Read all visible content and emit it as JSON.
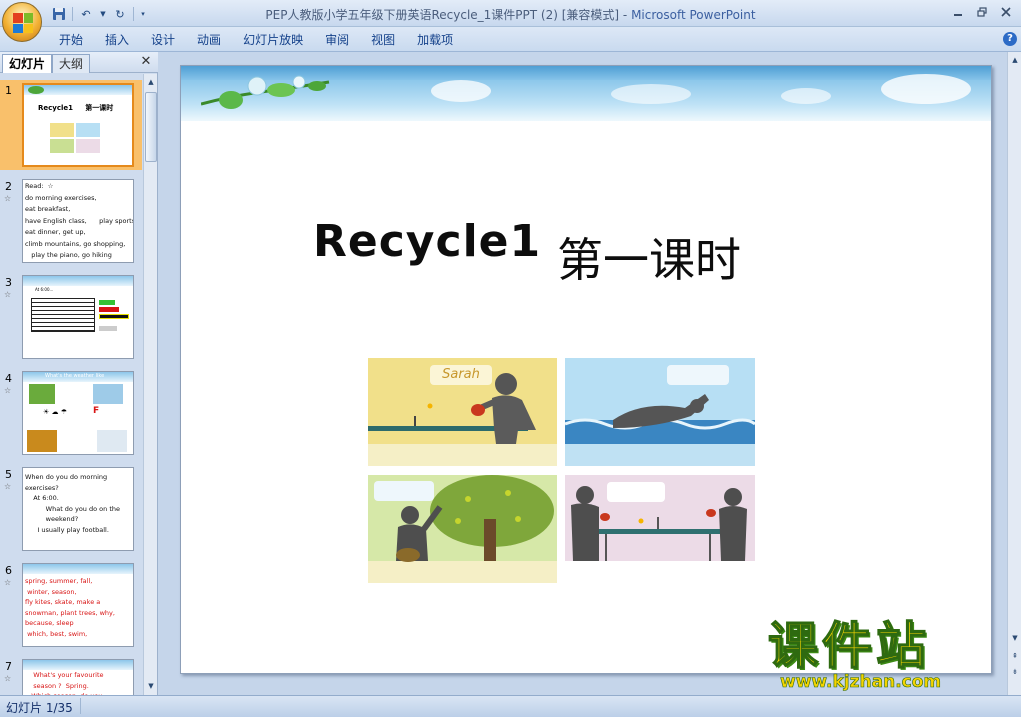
{
  "window": {
    "title": "PEP人教版小学五年级下册英语Recycle_1课件PPT (2) [兼容模式] - ",
    "app_name": "Microsoft PowerPoint",
    "controls": [
      "minimize-icon",
      "restore-icon",
      "close-icon"
    ]
  },
  "qat": {
    "icons": [
      "save-icon",
      "undo-icon",
      "redo-icon",
      "customize-icon"
    ]
  },
  "ribbon": {
    "tabs": [
      "开始",
      "插入",
      "设计",
      "动画",
      "幻灯片放映",
      "审阅",
      "视图",
      "加载项"
    ]
  },
  "left_pane": {
    "tab_slides": "幻灯片",
    "tab_outline": "大纲",
    "close": "✕",
    "thumbnails": [
      {
        "number": "1",
        "text": "Recycle1     第一课时",
        "selected": true
      },
      {
        "number": "2",
        "text": "Read:  ☆\ndo morning exercises,\neat breakfast,\nhave English class,      play sports,\neat dinner, get up,\nclimb mountains, go shopping,\n   play the piano, go hiking"
      },
      {
        "number": "3",
        "text": "At 6:00..."
      },
      {
        "number": "4",
        "text": "What's the weather like"
      },
      {
        "number": "5",
        "text": "When do you do morning\nexercises?\n    At 6:00.\n          What do you do on the\n          weekend?\n      I usually play football."
      },
      {
        "number": "6",
        "text": "spring, summer, fall,\n winter, season,\nfly kites, skate, make a\nsnowman, plant trees, why,\nbecause, sleep\n which, best, swim,",
        "red": true
      },
      {
        "number": "7",
        "text": "    What's your favourite\n    season ?  Spring.\n  -Which season  do you",
        "red": true
      }
    ]
  },
  "slide": {
    "title_en": "Recycle1",
    "title_cn": "第一课时",
    "photo1_label": "Sarah"
  },
  "status": {
    "slide_counter": "幻灯片 1/35"
  },
  "watermark": {
    "brand_cn": "课件站",
    "url": "www.kjzhan.com"
  },
  "colors": {
    "ribbon_text": "#15428b",
    "selected_thumb": "#f9c06b",
    "watermark_yellow": "#f5d400",
    "watermark_green": "#2e6a10"
  }
}
